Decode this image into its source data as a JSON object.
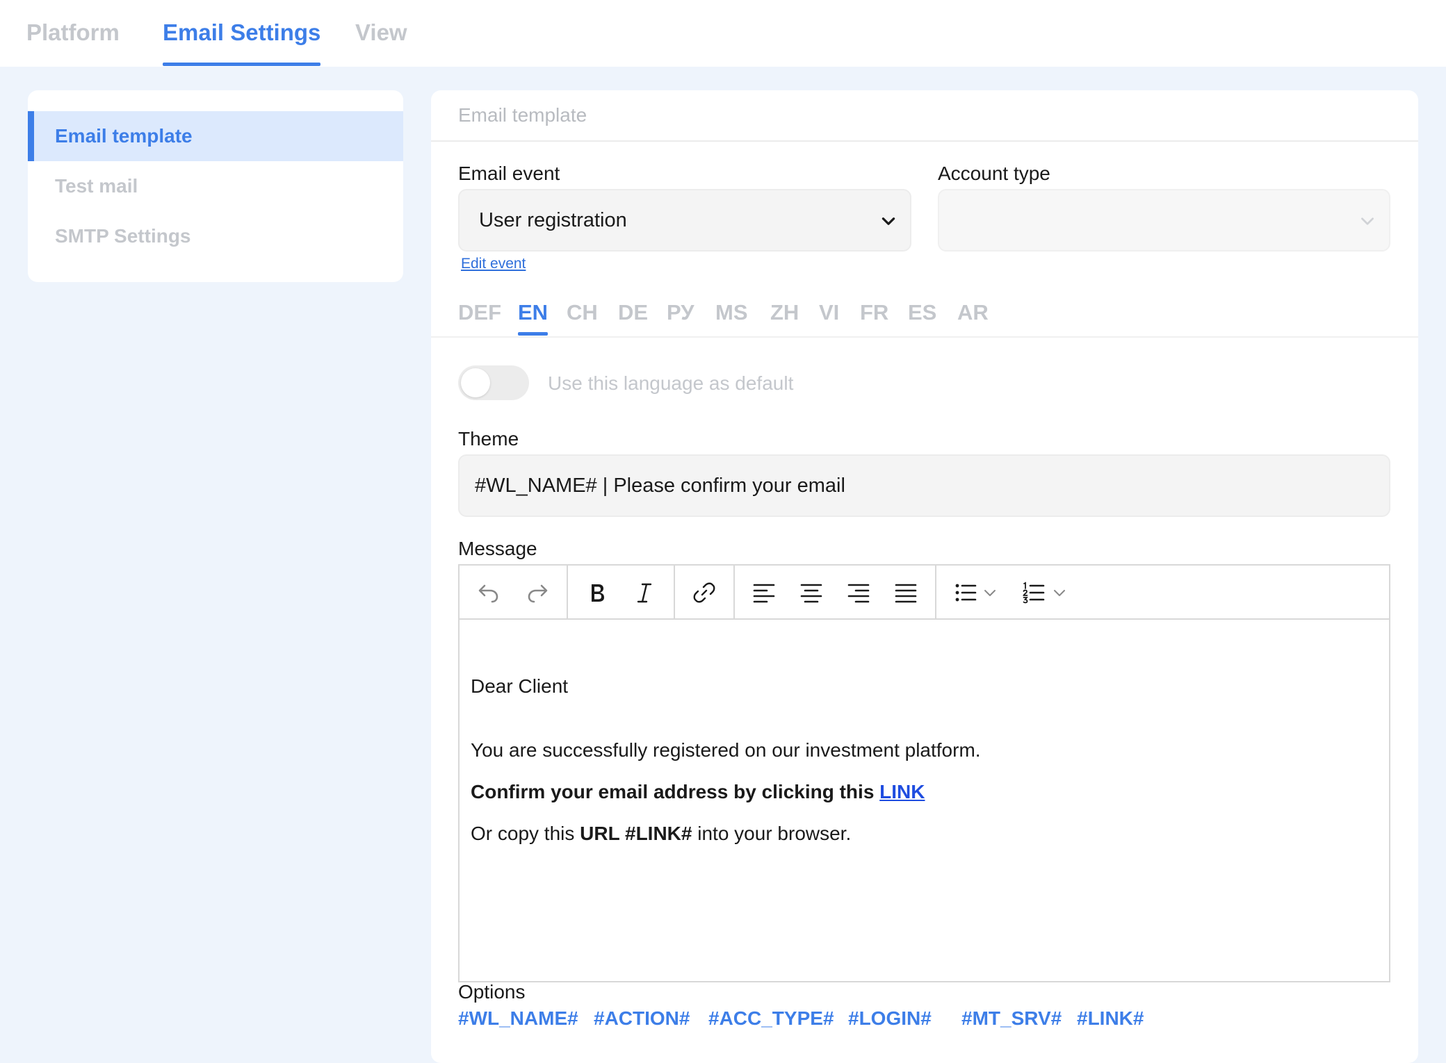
{
  "topnav": {
    "tabs": [
      {
        "label": "Platform"
      },
      {
        "label": "Email Settings"
      },
      {
        "label": "View"
      }
    ],
    "active": "Email Settings"
  },
  "sidebar": {
    "items": [
      {
        "label": "Email template"
      },
      {
        "label": "Test mail"
      },
      {
        "label": "SMTP Settings"
      }
    ],
    "active": "Email template"
  },
  "panel": {
    "title": "Email template",
    "email_event": {
      "label": "Email event",
      "value": "User registration"
    },
    "account_type": {
      "label": "Account type",
      "value": ""
    },
    "edit_event_label": "Edit event",
    "languages": [
      "DEF",
      "EN",
      "CH",
      "DE",
      "РУ",
      "MS",
      "ZH",
      "VI",
      "FR",
      "ES",
      "AR"
    ],
    "active_language": "EN",
    "default_toggle": {
      "label": "Use this language as default",
      "on": false
    },
    "theme": {
      "label": "Theme",
      "value": "#WL_NAME# | Please confirm your email"
    },
    "message": {
      "label": "Message",
      "greeting": "Dear Client",
      "line1": "You are successfully registered on our investment platform.",
      "line2_bold": "Confirm your email address by clicking this ",
      "line2_link": "LINK",
      "line3_prefix": "Or copy this ",
      "line3_bold": "URL #LINK#",
      "line3_suffix": " into your browser."
    },
    "toolbar_icons": [
      "undo-icon",
      "redo-icon",
      "bold-icon",
      "italic-icon",
      "link-icon",
      "align-left-icon",
      "align-center-icon",
      "align-right-icon",
      "align-justify-icon",
      "bullet-list-icon",
      "numbered-list-icon"
    ],
    "options": {
      "label": "Options",
      "items": [
        "#WL_NAME#",
        "#ACTION#",
        "#ACC_TYPE#",
        "#LOGIN#",
        "#MT_SRV#",
        "#LINK#"
      ]
    }
  },
  "colors": {
    "accent": "#3d7ee8",
    "muted": "#c4c7cc",
    "background": "#eef4fc",
    "link": "#1f4de0"
  }
}
